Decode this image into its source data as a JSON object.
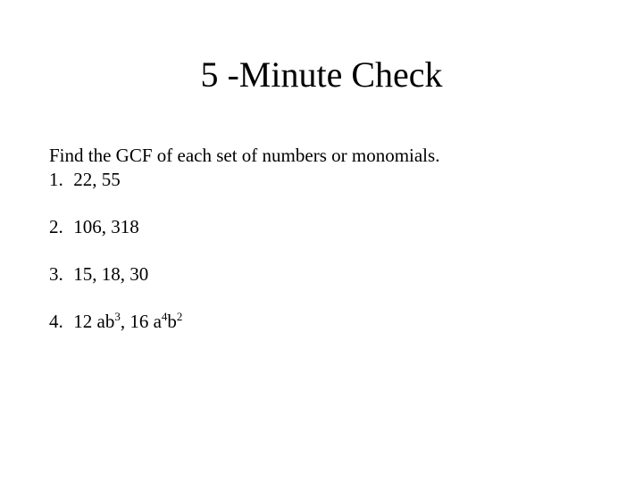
{
  "title": "5 -Minute Check",
  "instruction": "Find the GCF of each set of numbers or monomials.",
  "problems": [
    {
      "num": "1.",
      "text": "22, 55"
    },
    {
      "num": "2.",
      "text": "106, 318"
    },
    {
      "num": "3.",
      "text": "15, 18, 30"
    },
    {
      "num": "4.",
      "html": "12 ab<sup>3</sup>, 16 a<sup>4</sup>b<sup>2</sup>"
    }
  ]
}
